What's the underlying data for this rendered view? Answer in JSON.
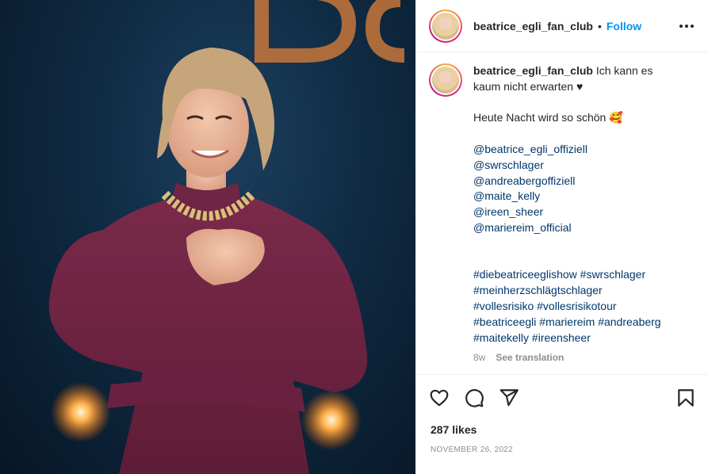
{
  "post": {
    "image_alt": "Photo of a smiling blonde woman in a burgundy long-sleeve outfit with a gold chain necklace on stage",
    "username": "beatrice_egli_fan_club",
    "dot": "•",
    "follow_label": "Follow",
    "more_icon": "more-dots-icon"
  },
  "caption": {
    "username": "beatrice_egli_fan_club",
    "line1_rest": " Ich kann es",
    "line2": "kaum nicht erwarten ♥",
    "line3": "Heute Nacht wird so schön 🥰",
    "mentions": [
      "@beatrice_egli_offiziell",
      "@swrschlager",
      "@andreabergoffiziell",
      "@maite_kelly",
      "@ireen_sheer",
      "@mariereim_official"
    ],
    "hashtag_lines": [
      [
        "#diebeatriceeglishow",
        "#swrschlager"
      ],
      [
        "#meinherzschlägtschlager"
      ],
      [
        "#vollesrisiko",
        "#vollesrisikotour"
      ],
      [
        "#beatriceegli",
        "#mariereim",
        "#andreaberg"
      ],
      [
        "#maitekelly",
        "#ireensheer"
      ]
    ],
    "age": "8w",
    "translate_label": "See translation"
  },
  "actions": {
    "like_icon": "heart-icon",
    "comment_icon": "comment-icon",
    "share_icon": "share-icon",
    "save_icon": "bookmark-icon"
  },
  "likes": "287 likes",
  "date": "NOVEMBER 26, 2022"
}
